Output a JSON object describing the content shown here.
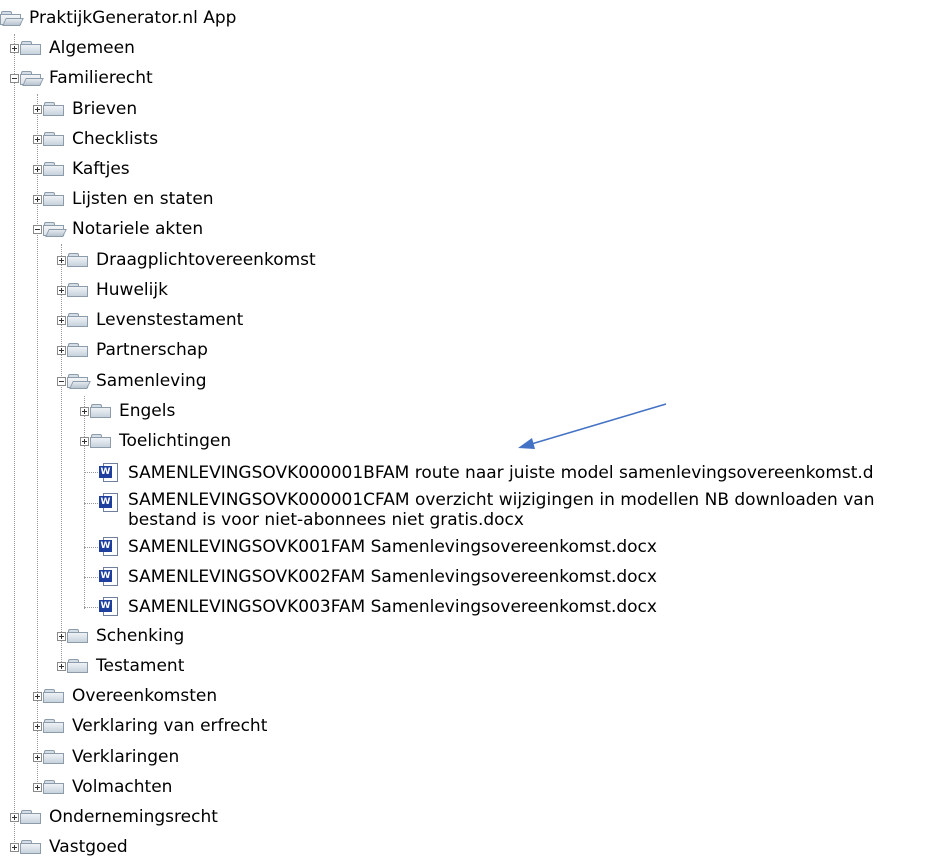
{
  "tree": {
    "root": "PraktijkGenerator.nl App",
    "algemeen": "Algemeen",
    "familierecht": "Familierecht",
    "brieven": "Brieven",
    "checklists": "Checklists",
    "kaftjes": "Kaftjes",
    "lijsten": "Lijsten en staten",
    "notariele": "Notariele akten",
    "draagplicht": "Draagplichtovereenkomst",
    "huwelijk": "Huwelijk",
    "levenstestament": "Levenstestament",
    "partnerschap": "Partnerschap",
    "samenleving": "Samenleving",
    "engels": "Engels",
    "toelichtingen": "Toelichtingen",
    "doc1": "SAMENLEVINGSOVK000001BFAM route naar juiste model samenlevingsovereenkomst.d",
    "doc2_line1": "SAMENLEVINGSOVK000001CFAM overzicht wijzigingen in modellen NB downloaden van",
    "doc2_line2": "bestand is voor niet-abonnees niet gratis.docx",
    "doc3": "SAMENLEVINGSOVK001FAM Samenlevingsovereenkomst.docx",
    "doc4": "SAMENLEVINGSOVK002FAM Samenlevingsovereenkomst.docx",
    "doc5": "SAMENLEVINGSOVK003FAM Samenlevingsovereenkomst.docx",
    "schenking": "Schenking",
    "testament": "Testament",
    "overeenkomsten": "Overeenkomsten",
    "verklaring_erfrecht": "Verklaring van erfrecht",
    "verklaringen": "Verklaringen",
    "volmachten": "Volmachten",
    "ondernemingsrecht": "Ondernemingsrecht",
    "vastgoed": "Vastgoed"
  },
  "colors": {
    "annotation_arrow": "#4472c4",
    "word_icon": "#1f3f9f",
    "tree_lines": "#9a9a9a"
  },
  "icons": {
    "folder": "folder-icon",
    "open_folder": "folder-open-icon",
    "document": "word-document-icon",
    "expand": "expand-plus-icon",
    "collapse": "collapse-minus-icon"
  }
}
